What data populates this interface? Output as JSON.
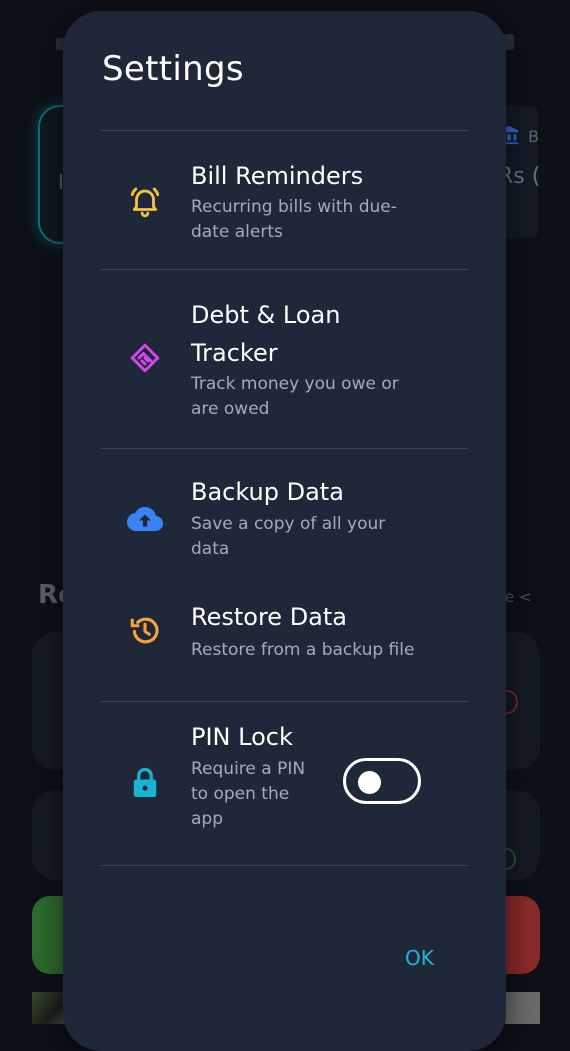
{
  "dialog": {
    "title": "Settings",
    "items": [
      {
        "title": "Bill Reminders",
        "subtitle_lines": [
          "Recurring bills with due-",
          "date alerts"
        ],
        "icon": "bell-ring-icon",
        "icon_color": "#f5c242"
      },
      {
        "title_lines": [
          "Debt & Loan",
          "Tracker"
        ],
        "subtitle_lines": [
          "Track money you owe or",
          "are owed"
        ],
        "icon": "handshake-icon",
        "icon_color": "#d147e8"
      },
      {
        "title": "Backup Data",
        "subtitle_lines": [
          "Save a copy of all your",
          "data"
        ],
        "icon": "cloud-upload-icon",
        "icon_color": "#3b82f6"
      },
      {
        "title": "Restore Data",
        "subtitle_lines": [
          "Restore from a backup file"
        ],
        "icon": "history-icon",
        "icon_color": "#f6a33a"
      },
      {
        "title": "PIN Lock",
        "subtitle_lines": [
          "Require a PIN",
          "to open the",
          "app"
        ],
        "icon": "lock-icon",
        "icon_color": "#18b4d4",
        "toggle_on": false
      }
    ],
    "ok_label": "OK"
  },
  "background": {
    "section_heading": "Re",
    "see_more": "e <",
    "left_card_letter": "I",
    "right_card_letter": "B",
    "right_card_amount": "Rs (",
    "bank_icon": "bank-icon"
  },
  "colors": {
    "dialog_bg": "#1f2839",
    "accent": "#20b6d8",
    "subtitle": "#a4acba"
  }
}
